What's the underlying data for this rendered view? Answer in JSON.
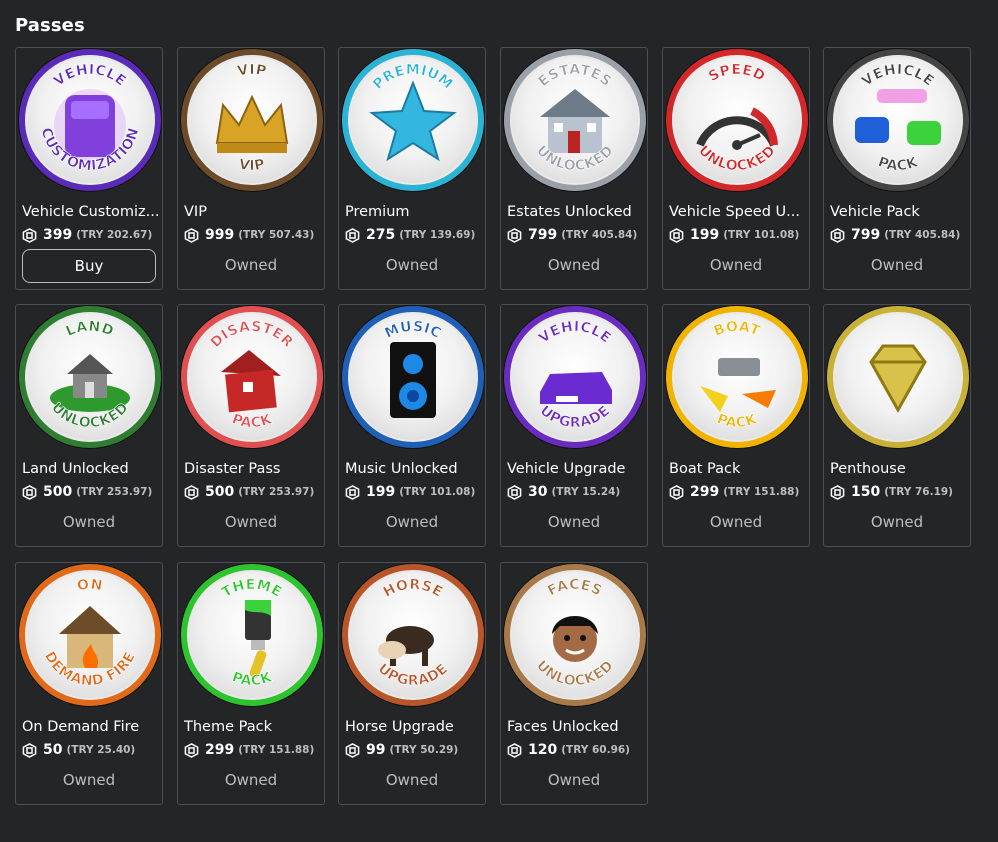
{
  "section": {
    "title": "Passes"
  },
  "passes": [
    {
      "name": "Vehicle Customiz...",
      "price": "399",
      "local": "(TRY 202.67)",
      "status": "Buy",
      "top": "VEHICLE",
      "bottom": "CUSTOMIZATION",
      "ring": "#5a2bb8",
      "art": "car-icon"
    },
    {
      "name": "VIP",
      "price": "999",
      "local": "(TRY 507.43)",
      "status": "Owned",
      "top": "VIP",
      "bottom": "VIP",
      "ring": "#6b4b2a",
      "art": "crown-icon"
    },
    {
      "name": "Premium",
      "price": "275",
      "local": "(TRY 139.69)",
      "status": "Owned",
      "top": "PREMIUM",
      "bottom": "",
      "ring": "#2bb3d6",
      "art": "star-icon"
    },
    {
      "name": "Estates Unlocked",
      "price": "799",
      "local": "(TRY 405.84)",
      "status": "Owned",
      "top": "ESTATES",
      "bottom": "UNLOCKED",
      "ring": "#9aa0a8",
      "art": "house-icon"
    },
    {
      "name": "Vehicle Speed U...",
      "price": "199",
      "local": "(TRY 101.08)",
      "status": "Owned",
      "top": "SPEED",
      "bottom": "UNLOCKED",
      "ring": "#d4272a",
      "art": "speedometer-icon"
    },
    {
      "name": "Vehicle Pack",
      "price": "799",
      "local": "(TRY 405.84)",
      "status": "Owned",
      "top": "VEHICLE",
      "bottom": "PACK",
      "ring": "#444444",
      "art": "cars-icon"
    },
    {
      "name": "Land Unlocked",
      "price": "500",
      "local": "(TRY 253.97)",
      "status": "Owned",
      "top": "LAND",
      "bottom": "UNLOCKED",
      "ring": "#2e7d32",
      "art": "land-icon"
    },
    {
      "name": "Disaster Pass",
      "price": "500",
      "local": "(TRY 253.97)",
      "status": "Owned",
      "top": "DISASTER",
      "bottom": "PACK",
      "ring": "#e05050",
      "art": "broken-house-icon"
    },
    {
      "name": "Music Unlocked",
      "price": "199",
      "local": "(TRY 101.08)",
      "status": "Owned",
      "top": "MUSIC",
      "bottom": "",
      "ring": "#1f5fb8",
      "art": "speaker-icon"
    },
    {
      "name": "Vehicle Upgrade",
      "price": "30",
      "local": "(TRY 15.24)",
      "status": "Owned",
      "top": "VEHICLE",
      "bottom": "UPGRADE",
      "ring": "#6a2bc0",
      "art": "car-upgrade-icon"
    },
    {
      "name": "Boat Pack",
      "price": "299",
      "local": "(TRY 151.88)",
      "status": "Owned",
      "top": "BOAT",
      "bottom": "PACK",
      "ring": "#f0b400",
      "art": "boat-icon"
    },
    {
      "name": "Penthouse",
      "price": "150",
      "local": "(TRY 76.19)",
      "status": "Owned",
      "top": "",
      "bottom": "",
      "ring": "#c9b037",
      "art": "diamond-icon"
    },
    {
      "name": "On Demand Fire",
      "price": "50",
      "local": "(TRY 25.40)",
      "status": "Owned",
      "top": "ON",
      "bottom": "DEMAND FIRE",
      "ring": "#e06a1a",
      "art": "fire-house-icon"
    },
    {
      "name": "Theme Pack",
      "price": "299",
      "local": "(TRY 151.88)",
      "status": "Owned",
      "top": "THEME",
      "bottom": "PACK",
      "ring": "#2ec42e",
      "art": "brush-icon"
    },
    {
      "name": "Horse Upgrade",
      "price": "99",
      "local": "(TRY 50.29)",
      "status": "Owned",
      "top": "HORSE",
      "bottom": "UPGRADE",
      "ring": "#b8562a",
      "art": "horse-icon"
    },
    {
      "name": "Faces Unlocked",
      "price": "120",
      "local": "(TRY 60.96)",
      "status": "Owned",
      "top": "FACES",
      "bottom": "UNLOCKED",
      "ring": "#a87a4a",
      "art": "face-icon"
    }
  ]
}
